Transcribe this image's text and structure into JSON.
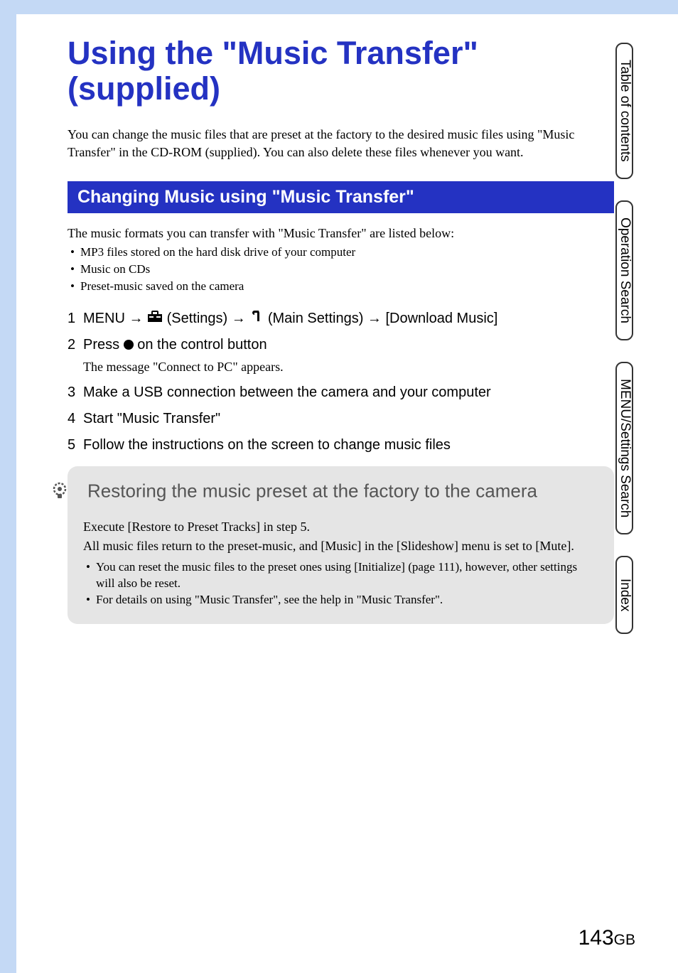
{
  "title": "Using the \"Music Transfer\" (supplied)",
  "intro": "You can change the music files that are preset at the factory to the desired music files using \"Music Transfer\" in the CD-ROM (supplied). You can also delete these files whenever you want.",
  "section_heading": "Changing Music using \"Music Transfer\"",
  "formats_intro": "The music formats you can transfer with \"Music Transfer\" are listed below:",
  "format_bullets": [
    "MP3 files stored on the hard disk drive of your computer",
    "Music on CDs",
    "Preset-music saved on the camera"
  ],
  "steps": {
    "s1_a": "MENU ",
    "s1_b": " (Settings) ",
    "s1_c": " (Main Settings) ",
    "s1_d": " [Download Music]",
    "s2_a": "Press ",
    "s2_b": " on the control button",
    "s2_note": "The message \"Connect to PC\" appears.",
    "s3": "Make a USB connection between the camera and your computer",
    "s4": "Start \"Music Transfer\"",
    "s5": "Follow the instructions on the screen to change music files"
  },
  "arrow": "→",
  "tip": {
    "title": "Restoring the music preset at the factory to the camera",
    "p1": "Execute [Restore to Preset Tracks] in step 5.",
    "p2": "All music files return to the preset-music, and [Music] in the [Slideshow] menu is set to [Mute].",
    "bullets": [
      "You can reset the music files to the preset ones using [Initialize] (page 111), however, other settings will also be reset.",
      "For details on using \"Music Transfer\", see the help in \"Music Transfer\"."
    ]
  },
  "tabs": [
    "Table of contents",
    "Operation Search",
    "MENU/Settings Search",
    "Index"
  ],
  "page_number": "143",
  "page_suffix": "GB"
}
